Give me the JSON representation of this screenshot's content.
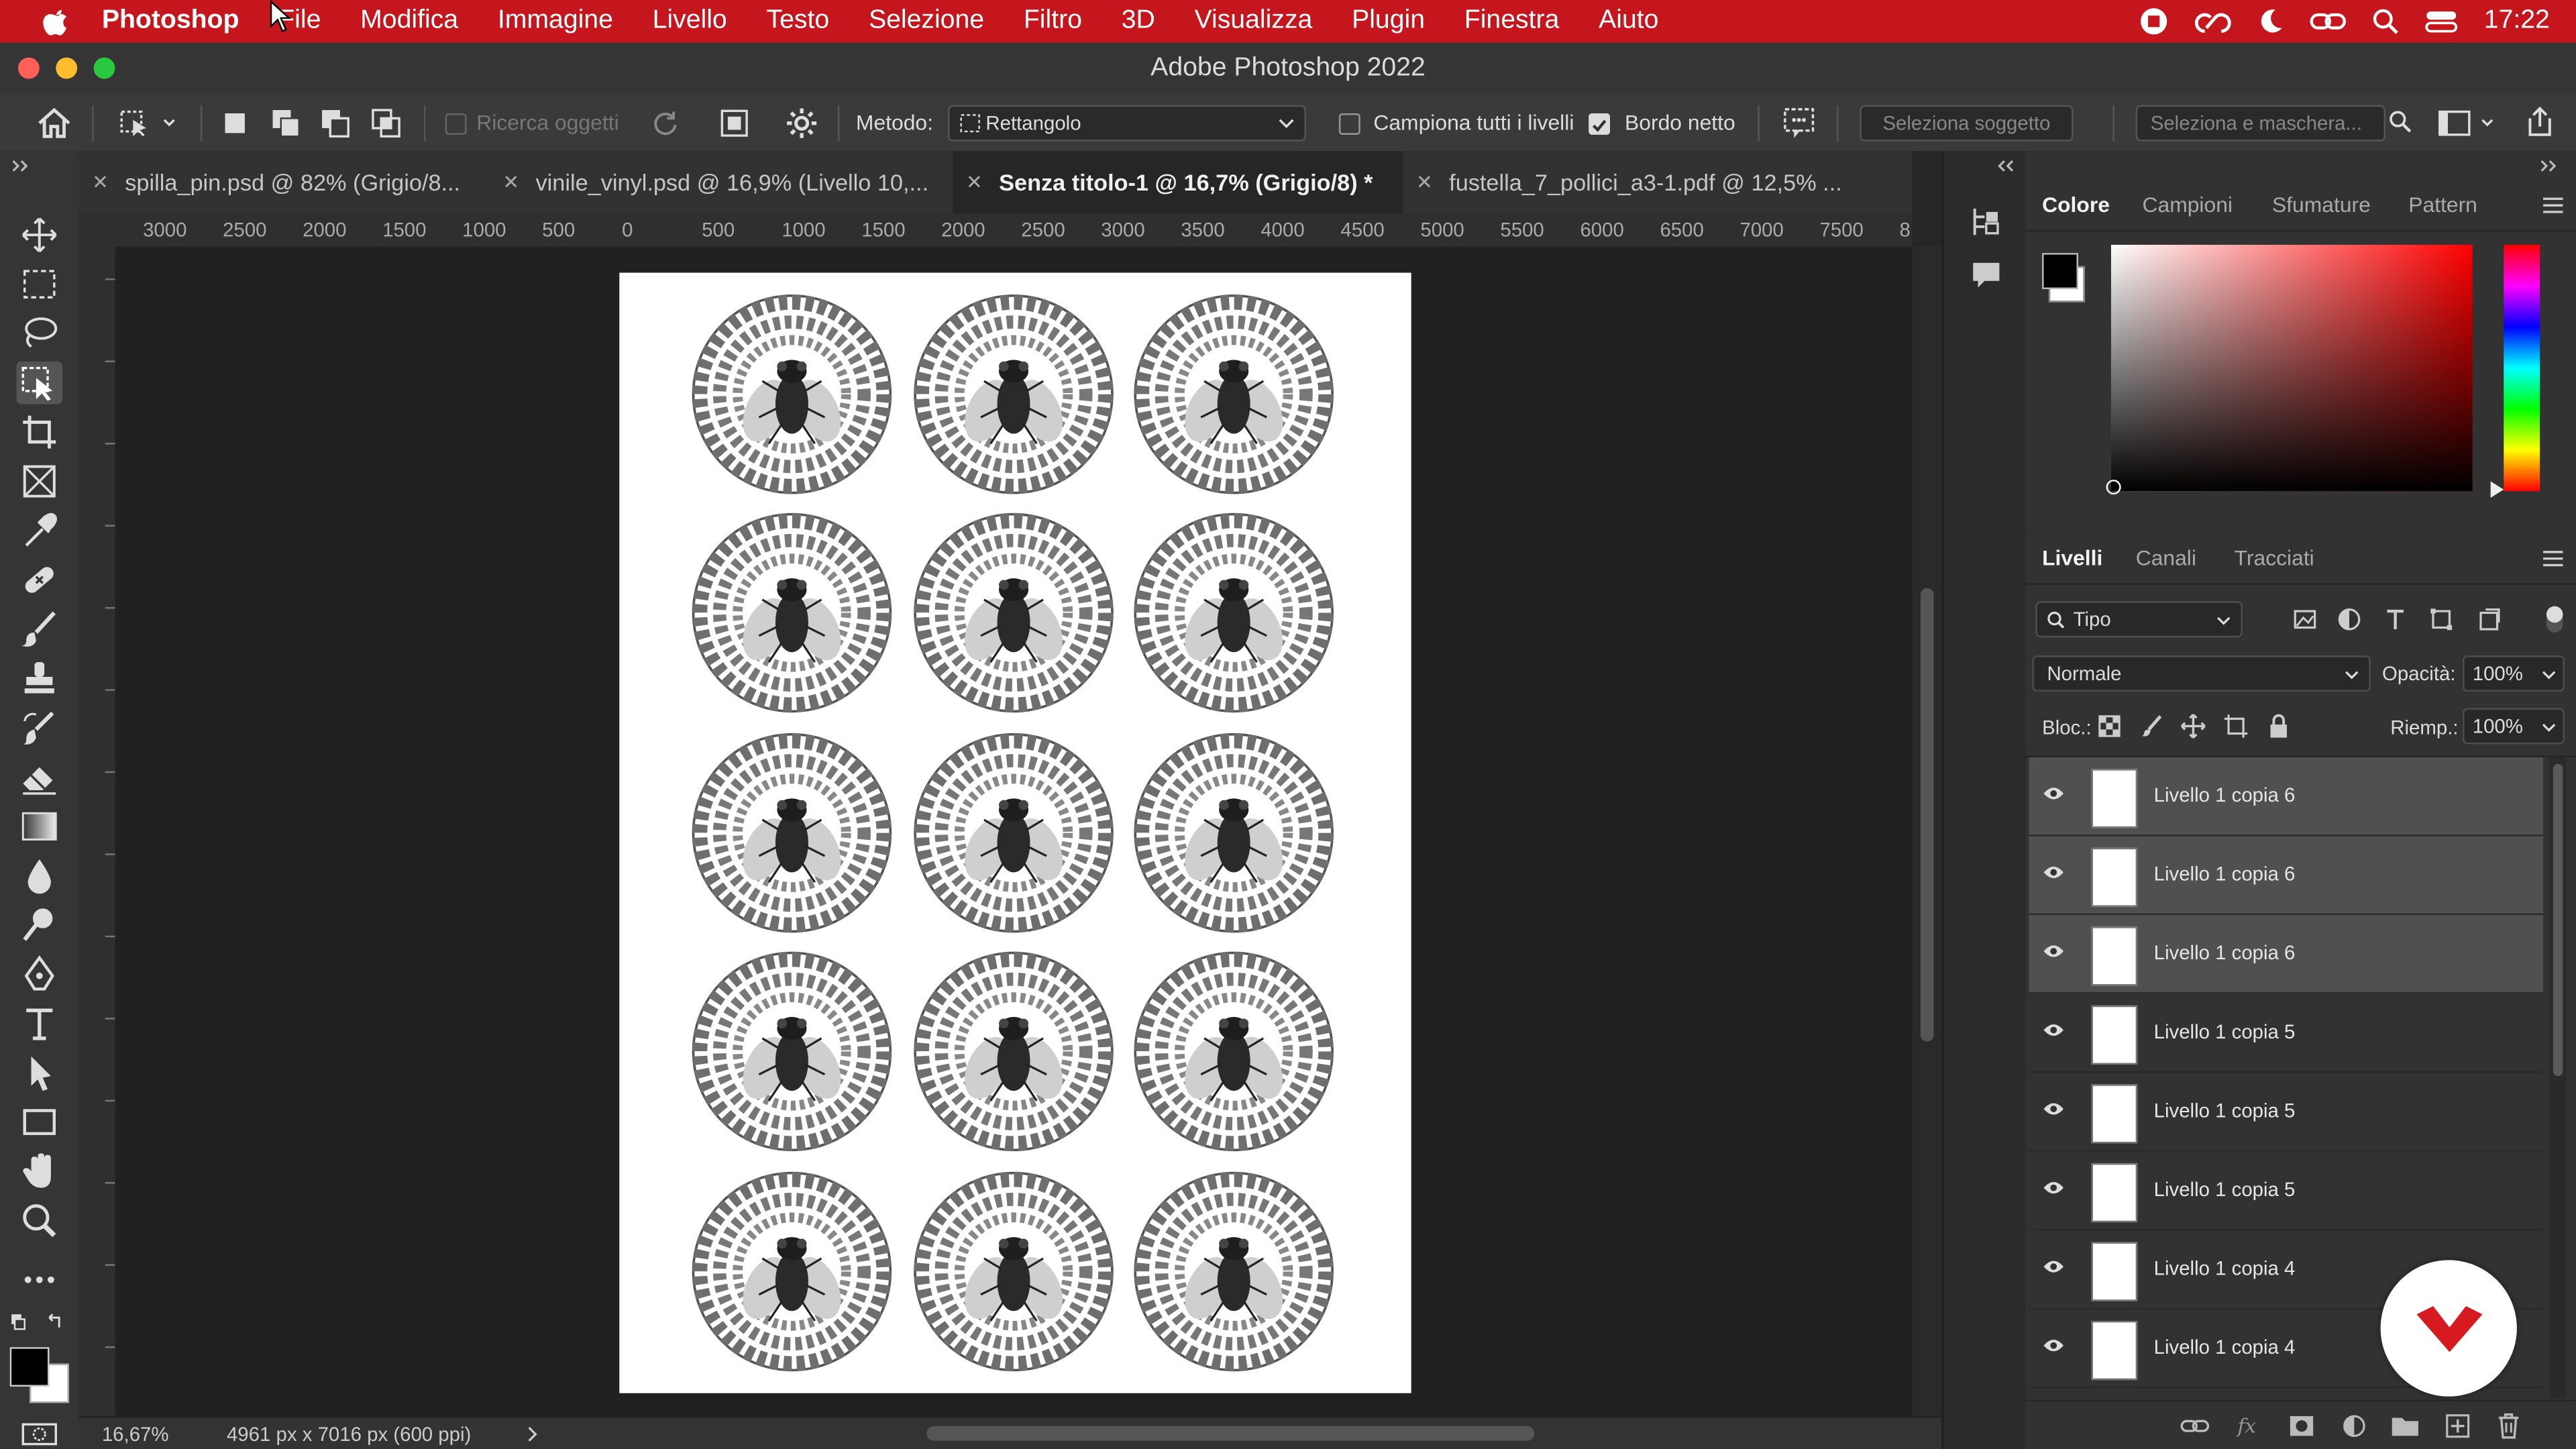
{
  "menubar": {
    "app": "Photoshop",
    "items": [
      "File",
      "Modifica",
      "Immagine",
      "Livello",
      "Testo",
      "Selezione",
      "Filtro",
      "3D",
      "Visualizza",
      "Plugin",
      "Finestra",
      "Aiuto"
    ],
    "clock": "17:22"
  },
  "window": {
    "title": "Adobe Photoshop 2022"
  },
  "options": {
    "search_objects": "Ricerca oggetti",
    "method_label": "Metodo:",
    "method_value": "Rettangolo",
    "sample_all_label": "Campiona tutti i livelli",
    "hard_edge_label": "Bordo netto",
    "select_subject": "Seleziona soggetto",
    "select_mask": "Seleziona e maschera..."
  },
  "tabs": [
    {
      "label": "spilla_pin.psd @ 82% (Grigio/8...",
      "active": false
    },
    {
      "label": "vinile_vinyl.psd @ 16,9% (Livello 10,...",
      "active": false
    },
    {
      "label": "Senza titolo-1 @ 16,7% (Grigio/8) *",
      "active": true
    },
    {
      "label": "fustella_7_pollici_a3-1.pdf @ 12,5% ...",
      "active": false
    }
  ],
  "ruler": {
    "ticks": [
      "3000",
      "2500",
      "2000",
      "1500",
      "1000",
      "500",
      "0",
      "500",
      "1000",
      "1500",
      "2000",
      "2500",
      "3000",
      "3500",
      "4000",
      "4500",
      "5000",
      "5500",
      "6000",
      "6500",
      "7000",
      "7500",
      "8"
    ]
  },
  "status": {
    "zoom": "16,67%",
    "doc_info": "4961 px x 7016 px (600 ppi)"
  },
  "color_panel": {
    "tabs": [
      "Colore",
      "Campioni",
      "Sfumature",
      "Pattern"
    ],
    "foreground": "#000000",
    "background": "#ffffff"
  },
  "layers_panel": {
    "tabs": [
      "Livelli",
      "Canali",
      "Tracciati"
    ],
    "filter_kind": "Tipo",
    "blend_mode": "Normale",
    "opacity_label": "Opacità:",
    "opacity": "100%",
    "lock_label": "Bloc.:",
    "fill_label": "Riemp.:",
    "fill": "100%",
    "layers": [
      {
        "name": "Livello 1 copia 6",
        "selected": true
      },
      {
        "name": "Livello 1 copia 6",
        "selected": true
      },
      {
        "name": "Livello 1 copia 6",
        "selected": true
      },
      {
        "name": "Livello 1 copia 5",
        "selected": false
      },
      {
        "name": "Livello 1 copia 5",
        "selected": false
      },
      {
        "name": "Livello 1 copia 5",
        "selected": false
      },
      {
        "name": "Livello 1 copia 4",
        "selected": false
      },
      {
        "name": "Livello 1 copia 4",
        "selected": false
      }
    ]
  },
  "colors": {
    "menubar": "#c4161c",
    "brand_badge": "#d71920"
  }
}
